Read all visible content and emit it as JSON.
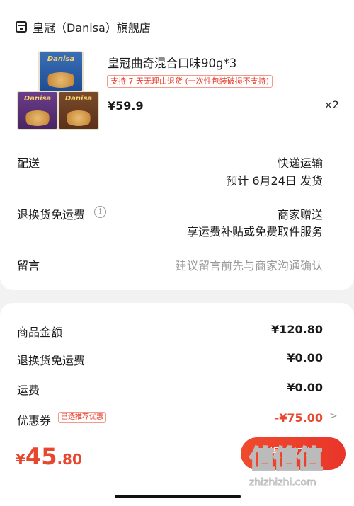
{
  "shop": {
    "name": "皇冠（Danisa）旗舰店",
    "icon": "store-icon"
  },
  "product": {
    "title": "皇冠曲奇混合口味90g*3",
    "return_badge": "支持 7 天无理由退货 (一次性包装破损不支持)",
    "price": "¥59.9",
    "quantity": "×2",
    "image_boxes": [
      "Danisa",
      "Danisa",
      "Danisa"
    ]
  },
  "delivery": {
    "label": "配送",
    "method": "快递运输",
    "eta": "预计 6月24日 发货"
  },
  "return_insurance": {
    "label": "退换货免运费",
    "info_icon": "info-icon",
    "provider": "商家赠送",
    "description": "享运费补贴或免费取件服务"
  },
  "message": {
    "label": "留言",
    "placeholder": "建议留言前先与商家沟通确认"
  },
  "summary": {
    "goods_amount_label": "商品金额",
    "goods_amount": "¥120.80",
    "return_fee_label": "退换货免运费",
    "return_fee": "¥0.00",
    "shipping_label": "运费",
    "shipping": "¥0.00",
    "coupon_label": "优惠券",
    "coupon_badge": "已选推荐优惠",
    "coupon_amount": "-¥75.00"
  },
  "footer": {
    "currency": "¥",
    "total_int": "45",
    "total_dec": ".80",
    "submit_label": "提交订单"
  },
  "watermark": {
    "glyphs": "值值值",
    "url": "zhizhizhi.com"
  },
  "colors": {
    "accent": "#e8472f",
    "badge_border": "#f29a8c",
    "background": "#f2f2f2"
  }
}
